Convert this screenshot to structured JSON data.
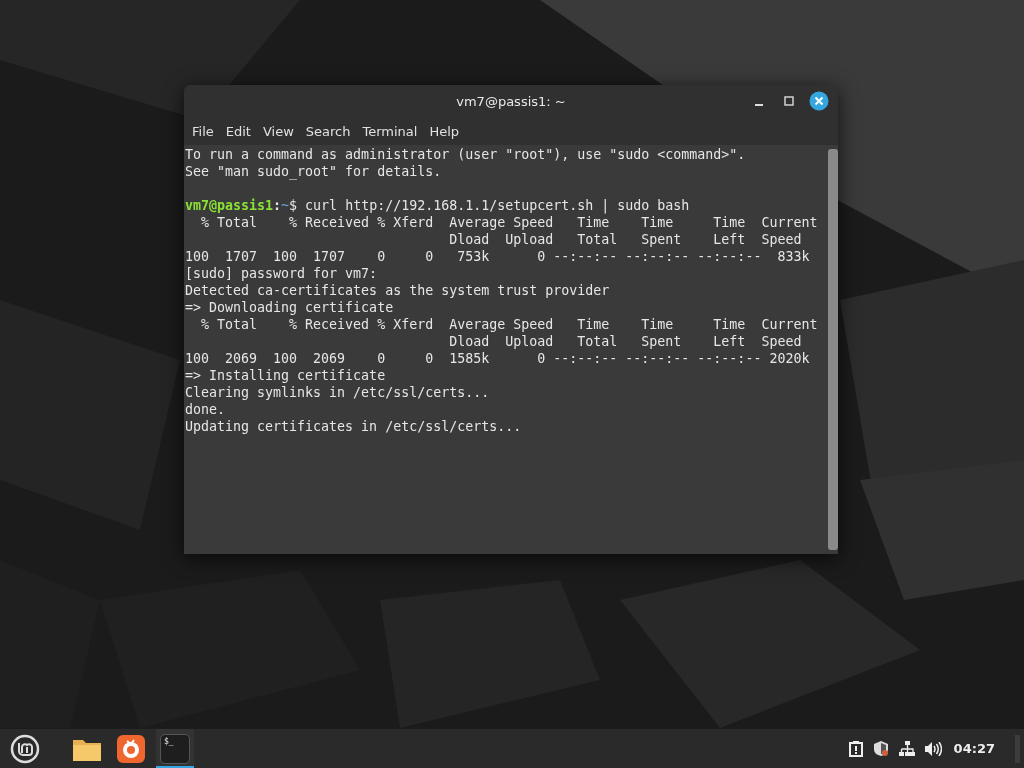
{
  "window": {
    "title": "vm7@passis1: ~",
    "menu": [
      "File",
      "Edit",
      "View",
      "Search",
      "Terminal",
      "Help"
    ],
    "lines": [
      {
        "kind": "text",
        "text": "To run a command as administrator (user \"root\"), use \"sudo <command>\"."
      },
      {
        "kind": "text",
        "text": "See \"man sudo_root\" for details."
      },
      {
        "kind": "blank"
      },
      {
        "kind": "prompt",
        "segments": [
          {
            "text": "vm7@passis1",
            "color": "#8ae234"
          },
          {
            "text": ":",
            "color": "#e6e6e6"
          },
          {
            "text": "~",
            "color": "#729fcf"
          },
          {
            "text": "$ curl http://192.168.1.1/setupcert.sh | sudo bash",
            "color": "#e6e6e6"
          }
        ]
      },
      {
        "kind": "text",
        "text": "  % Total    % Received % Xferd  Average Speed   Time    Time     Time  Current"
      },
      {
        "kind": "text",
        "text": "                                 Dload  Upload   Total   Spent    Left  Speed"
      },
      {
        "kind": "text",
        "text": "100  1707  100  1707    0     0   753k      0 --:--:-- --:--:-- --:--:--  833k"
      },
      {
        "kind": "text",
        "text": "[sudo] password for vm7:"
      },
      {
        "kind": "text",
        "text": "Detected ca-certificates as the system trust provider"
      },
      {
        "kind": "text",
        "text": "=> Downloading certificate"
      },
      {
        "kind": "text",
        "text": "  % Total    % Received % Xferd  Average Speed   Time    Time     Time  Current"
      },
      {
        "kind": "text",
        "text": "                                 Dload  Upload   Total   Spent    Left  Speed"
      },
      {
        "kind": "text",
        "text": "100  2069  100  2069    0     0  1585k      0 --:--:-- --:--:-- --:--:-- 2020k"
      },
      {
        "kind": "text",
        "text": "=> Installing certificate"
      },
      {
        "kind": "text",
        "text": "Clearing symlinks in /etc/ssl/certs..."
      },
      {
        "kind": "text",
        "text": "done."
      },
      {
        "kind": "text",
        "text": "Updating certificates in /etc/ssl/certs..."
      }
    ]
  },
  "taskbar": {
    "apps": [
      {
        "kind": "menu",
        "selected": false
      },
      {
        "kind": "files",
        "selected": false
      },
      {
        "kind": "browser",
        "selected": false
      },
      {
        "kind": "terminal",
        "glyph": "$_",
        "selected": true
      }
    ],
    "tray": [
      {
        "kind": "update"
      },
      {
        "kind": "shield"
      },
      {
        "kind": "network"
      },
      {
        "kind": "volume"
      }
    ],
    "clock": "04:27"
  }
}
